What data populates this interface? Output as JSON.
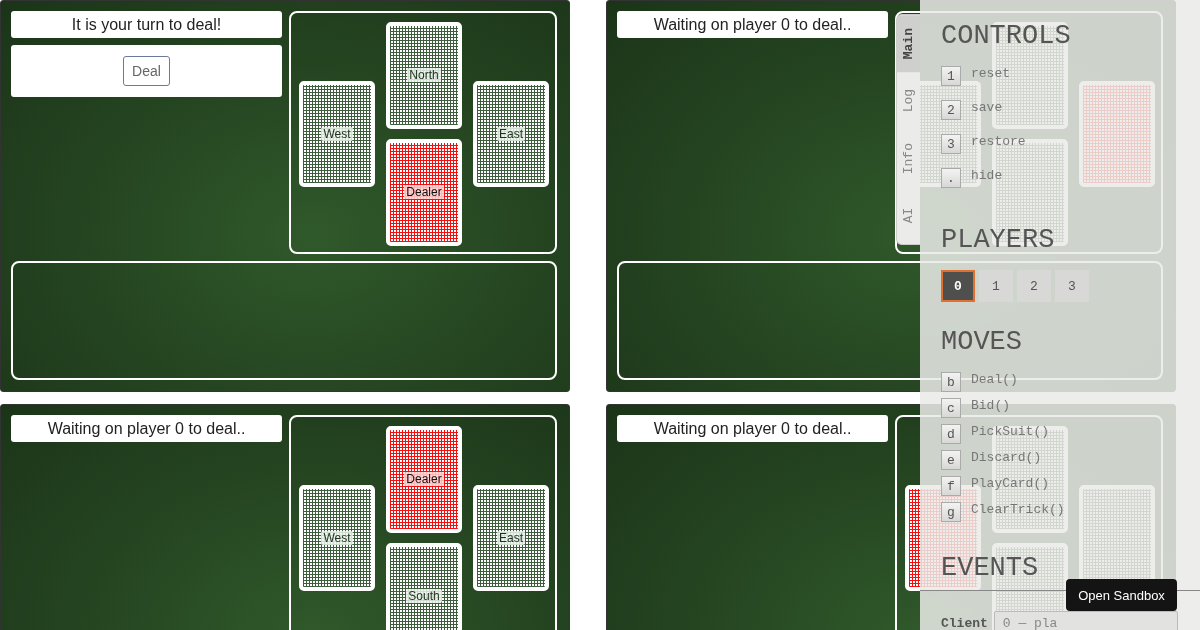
{
  "boards": [
    {
      "message": "It is your turn to deal!",
      "action_button": "Deal",
      "cards": [
        {
          "kind": "north",
          "label": "North",
          "dealer": false
        },
        {
          "kind": "west",
          "label": "West",
          "dealer": false
        },
        {
          "kind": "east",
          "label": "East",
          "dealer": false
        },
        {
          "kind": "south",
          "label": "Dealer",
          "dealer": true
        }
      ]
    },
    {
      "message": "Waiting on player 0 to deal..",
      "cards": [
        {
          "kind": "north",
          "dealer": false
        },
        {
          "kind": "west",
          "dealer": false
        },
        {
          "kind": "east",
          "dealer": true
        },
        {
          "kind": "south",
          "dealer": false
        }
      ]
    },
    {
      "message": "Waiting on player 0 to deal..",
      "cards": [
        {
          "kind": "north",
          "label": "Dealer",
          "dealer": true
        },
        {
          "kind": "west",
          "label": "West",
          "dealer": false
        },
        {
          "kind": "east",
          "label": "East",
          "dealer": false
        },
        {
          "kind": "south",
          "label": "South",
          "dealer": false
        }
      ]
    },
    {
      "message": "Waiting on player 0 to deal..",
      "cards": [
        {
          "kind": "north",
          "dealer": false
        },
        {
          "kind": "west",
          "dealer": true
        },
        {
          "kind": "east",
          "dealer": false
        },
        {
          "kind": "south",
          "dealer": false
        }
      ]
    }
  ],
  "debug_panel": {
    "tabs": [
      {
        "label": "Main",
        "selected": true
      },
      {
        "label": "Log",
        "selected": false
      },
      {
        "label": "Info",
        "selected": false
      },
      {
        "label": "AI",
        "selected": false
      }
    ],
    "controls": {
      "title": "CONTROLS",
      "items": [
        {
          "key": "1",
          "label": "reset"
        },
        {
          "key": "2",
          "label": "save"
        },
        {
          "key": "3",
          "label": "restore"
        },
        {
          "key": ".",
          "label": "hide"
        }
      ]
    },
    "players": {
      "title": "PLAYERS",
      "items": [
        {
          "label": "0",
          "selected": true
        },
        {
          "label": "1",
          "selected": false
        },
        {
          "label": "2",
          "selected": false
        },
        {
          "label": "3",
          "selected": false
        }
      ]
    },
    "moves": {
      "title": "MOVES",
      "items": [
        {
          "key": "b",
          "label": "Deal()"
        },
        {
          "key": "c",
          "label": "Bid()"
        },
        {
          "key": "d",
          "label": "PickSuit()"
        },
        {
          "key": "e",
          "label": "Discard()"
        },
        {
          "key": "f",
          "label": "PlayCard()"
        },
        {
          "key": "g",
          "label": "ClearTrick()"
        }
      ]
    },
    "events": {
      "title": "EVENTS"
    },
    "client": {
      "label": "Client",
      "value": "0 — pla"
    }
  },
  "sandbox_button": "Open Sandbox"
}
